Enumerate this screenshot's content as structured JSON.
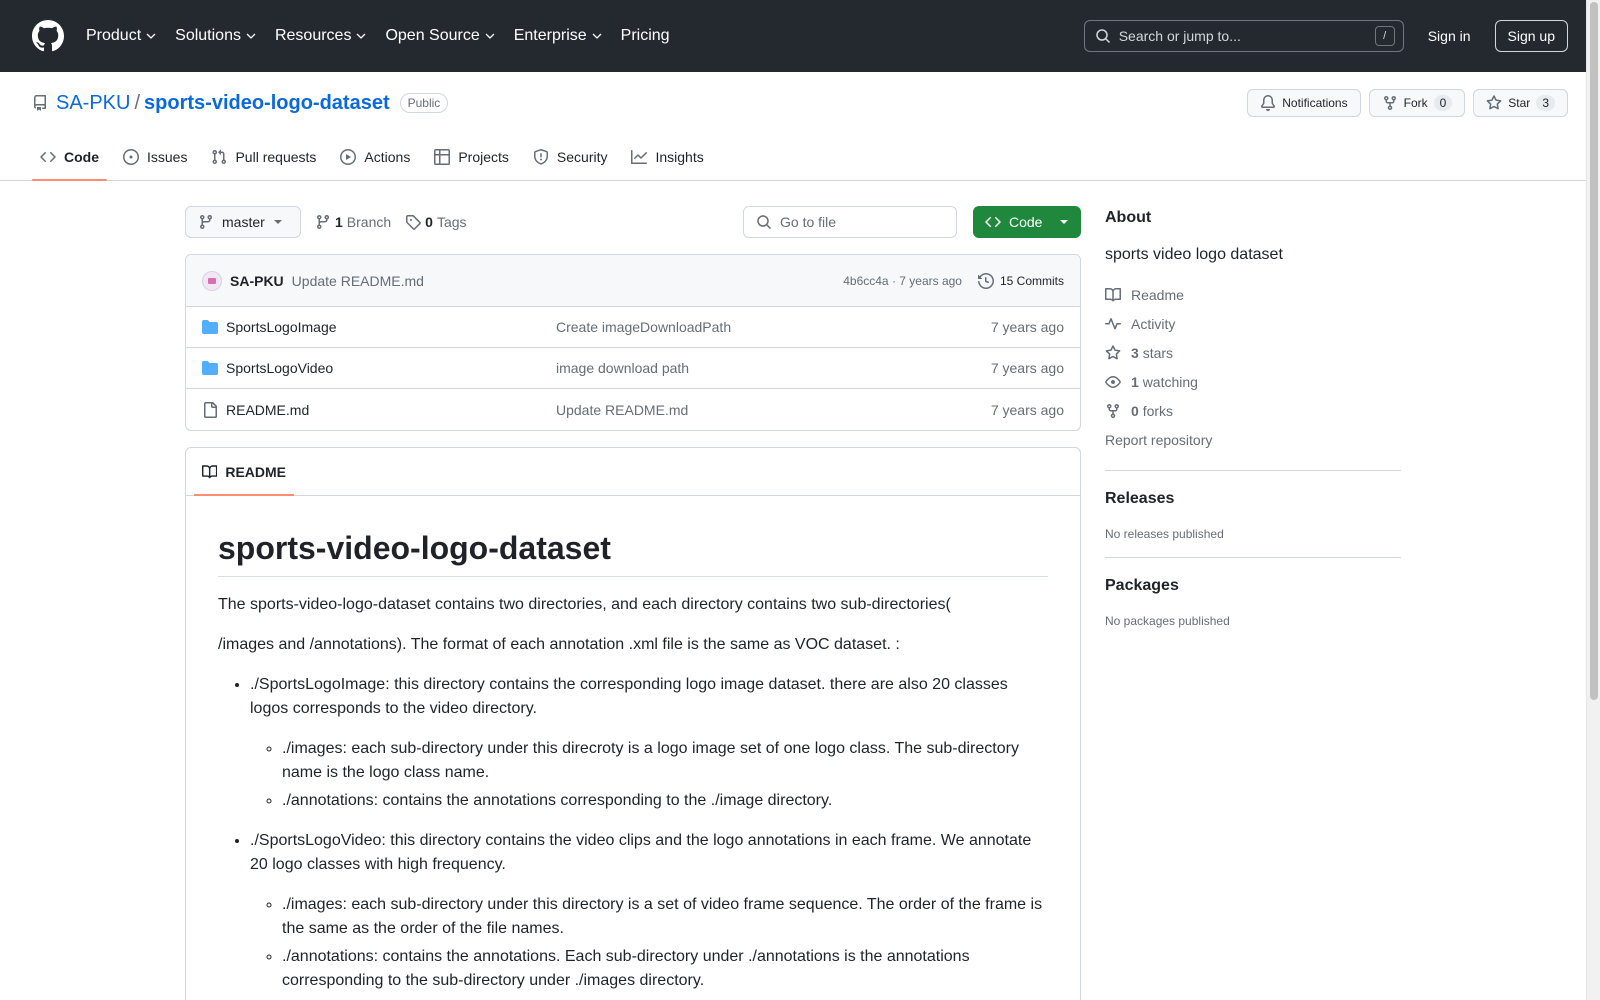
{
  "header": {
    "nav": [
      {
        "label": "Product",
        "has_menu": true
      },
      {
        "label": "Solutions",
        "has_menu": true
      },
      {
        "label": "Resources",
        "has_menu": true
      },
      {
        "label": "Open Source",
        "has_menu": true
      },
      {
        "label": "Enterprise",
        "has_menu": true
      },
      {
        "label": "Pricing",
        "has_menu": false
      }
    ],
    "search_placeholder": "Search or jump to...",
    "search_key": "/",
    "sign_in": "Sign in",
    "sign_up": "Sign up"
  },
  "repo": {
    "owner": "SA-PKU",
    "separator": "/",
    "name": "sports-video-logo-dataset",
    "visibility": "Public",
    "notifications_label": "Notifications",
    "fork_label": "Fork",
    "fork_count": "0",
    "star_label": "Star",
    "star_count": "3"
  },
  "tabs": [
    {
      "label": "Code",
      "icon": "code-icon",
      "active": true
    },
    {
      "label": "Issues",
      "icon": "issue-icon",
      "active": false
    },
    {
      "label": "Pull requests",
      "icon": "pull-request-icon",
      "active": false
    },
    {
      "label": "Actions",
      "icon": "play-icon",
      "active": false
    },
    {
      "label": "Projects",
      "icon": "table-icon",
      "active": false
    },
    {
      "label": "Security",
      "icon": "shield-icon",
      "active": false
    },
    {
      "label": "Insights",
      "icon": "graph-icon",
      "active": false
    }
  ],
  "toolbar": {
    "branch": "master",
    "branch_count": "1",
    "branch_label": "Branch",
    "tag_count": "0",
    "tag_label": "Tags",
    "go_to_file": "Go to file",
    "code_label": "Code"
  },
  "last_commit": {
    "author": "SA-PKU",
    "message": "Update README.md",
    "meta": "4b6cc4a · 7 years ago",
    "commits_label": "15 Commits"
  },
  "files": [
    {
      "type": "folder",
      "name": "SportsLogoImage",
      "commit": "Create imageDownloadPath",
      "age": "7 years ago"
    },
    {
      "type": "folder",
      "name": "SportsLogoVideo",
      "commit": "image download path",
      "age": "7 years ago"
    },
    {
      "type": "file",
      "name": "README.md",
      "commit": "Update README.md",
      "age": "7 years ago"
    }
  ],
  "readme": {
    "tab_label": "README",
    "title": "sports-video-logo-dataset",
    "para1": "The sports-video-logo-dataset contains two directories, and each directory contains two sub-directories(",
    "para2": "/images and /annotations). The format of each annotation .xml file is the same as VOC dataset. :",
    "item1": "./SportsLogoImage: this directory contains the corresponding logo image dataset. there are also 20 classes logos corresponds to the video directory.",
    "item1_sub1": "./images: each sub-directory under this direcroty is a logo image set of one logo class. The sub-directory name is the logo class name.",
    "item1_sub2": "./annotations: contains the annotations corresponding to the ./image directory.",
    "item2": "./SportsLogoVideo: this directory contains the video clips and the logo annotations in each frame. We annotate 20 logo classes with high frequency.",
    "item2_sub1": "./images: each sub-directory under this directory is a set of video frame sequence. The order of the frame is the same as the order of the file names.",
    "item2_sub2": "./annotations: contains the annotations. Each sub-directory under ./annotations is the annotations corresponding to the sub-directory under ./images directory."
  },
  "sidebar": {
    "about_title": "About",
    "description": "sports video logo dataset",
    "readme_link": "Readme",
    "activity_link": "Activity",
    "stars_count": "3",
    "stars_label": "stars",
    "watching_count": "1",
    "watching_label": "watching",
    "forks_count": "0",
    "forks_label": "forks",
    "report": "Report repository",
    "releases_title": "Releases",
    "releases_empty": "No releases published",
    "packages_title": "Packages",
    "packages_empty": "No packages published"
  },
  "colors": {
    "header_bg": "#24292f",
    "link": "#0969da",
    "code_button": "#1f883d",
    "tab_underline": "#fd8c73",
    "folder": "#54aeff"
  }
}
